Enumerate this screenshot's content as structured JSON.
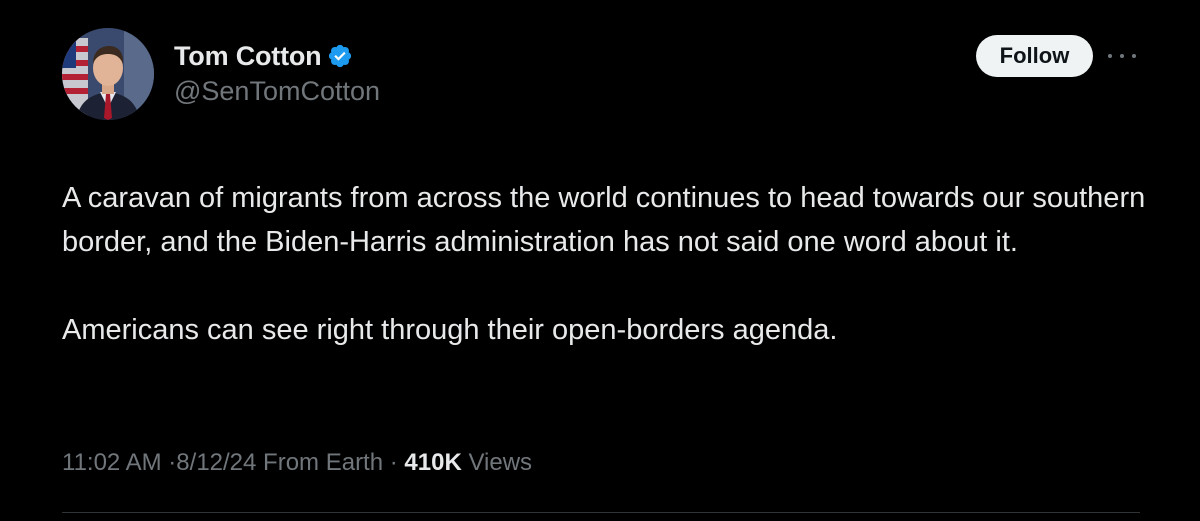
{
  "author": {
    "display_name": "Tom Cotton",
    "handle": "@SenTomCotton",
    "verified": true,
    "verified_icon": "verified-badge-icon",
    "verified_color": "#1d9bf0"
  },
  "actions": {
    "follow_label": "Follow",
    "more_icon": "more-options-icon"
  },
  "tweet": {
    "paragraphs": [
      "A caravan of migrants from across the world continues to head towards our southern border, and the Biden-Harris administration has not said one word about it.",
      "Americans can see right through their open-borders agenda."
    ]
  },
  "meta": {
    "time": "11:02 AM",
    "date": "8/12/24",
    "location": "From Earth",
    "views_count": "410K",
    "views_label": "Views",
    "separator": "·"
  },
  "colors": {
    "background": "#000000",
    "text_primary": "#e7e9ea",
    "text_secondary": "#71767b",
    "button_bg": "#eff3f4"
  }
}
